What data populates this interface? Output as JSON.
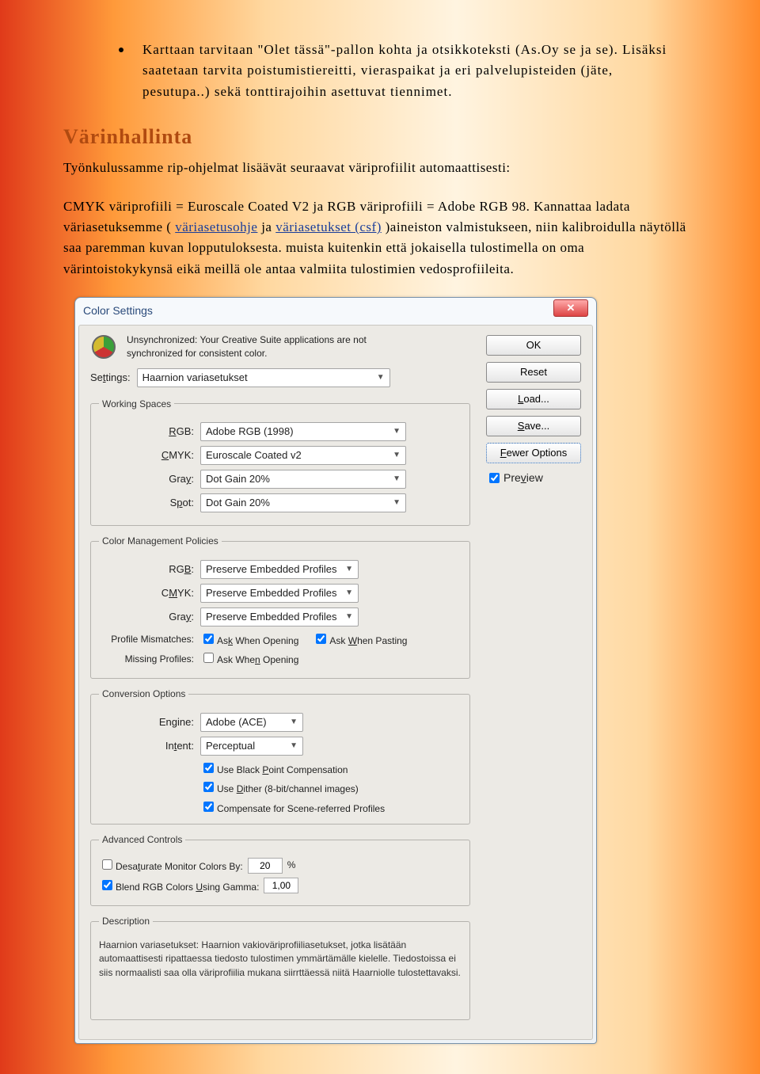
{
  "bullet1": "Karttaan tarvitaan \"Olet tässä\"-pallon kohta ja otsikkoteksti (As.Oy se ja se). Lisäksi saatetaan tarvita poistumistiereitti, vieraspaikat ja eri palvelupisteiden (jäte, pesutupa..) sekä tonttirajoihin asettuvat tiennimet.",
  "heading": "Värinhallinta",
  "para_intro": "Työnkulussamme rip-ohjelmat lisäävät seuraavat väriprofiilit automaattisesti:",
  "para2_a": "CMYK väriprofiili = Euroscale Coated V2 ja RGB väriprofiili =  Adobe RGB 98. Kannattaa ladata väriasetuksemme ( ",
  "para2_link1": "väriasetusohje",
  "para2_b": "  ja  ",
  "para2_link2": "väriasetukset (csf)",
  "para2_c": " )aineiston valmistukseen, niin kalibroidulla näytöllä saa paremman kuvan lopputuloksesta. muista kuitenkin että jokaisella tulostimella on oma värintoistokykynsä eikä meillä ole antaa valmiita tulostimien vedosprofiileita.",
  "dialog": {
    "title": "Color Settings",
    "unsync": "Unsynchronized: Your Creative Suite applications are not synchronized for consistent color.",
    "settings_label": "Settings:",
    "settings_value": "Haarnion variasetukset",
    "group_working": "Working Spaces",
    "rgb_label": "RGB:",
    "rgb_value": "Adobe RGB (1998)",
    "cmyk_label": "CMYK:",
    "cmyk_value": "Euroscale Coated v2",
    "gray_label": "Gray:",
    "gray_value": "Dot Gain 20%",
    "spot_label": "Spot:",
    "spot_value": "Dot Gain 20%",
    "group_policies": "Color Management Policies",
    "p_rgb_v": "Preserve Embedded Profiles",
    "p_cmyk_v": "Preserve Embedded Profiles",
    "p_gray_v": "Preserve Embedded Profiles",
    "mismatch_label": "Profile Mismatches:",
    "mismatch_open": "Ask When Opening",
    "mismatch_paste": "Ask When Pasting",
    "missing_label": "Missing Profiles:",
    "missing_open": "Ask When Opening",
    "group_conversion": "Conversion Options",
    "engine_label": "Engine:",
    "engine_value": "Adobe (ACE)",
    "intent_label": "Intent:",
    "intent_value": "Perceptual",
    "use_bpc": "Use Black Point Compensation",
    "use_dither": "Use Dither (8-bit/channel images)",
    "compensate_scene": "Compensate for Scene-referred Profiles",
    "group_advanced": "Advanced Controls",
    "desat_label": "Desaturate Monitor Colors By:",
    "desat_value": "20",
    "desat_unit": "%",
    "blend_label": "Blend RGB Colors Using Gamma:",
    "blend_value": "1,00",
    "group_description": "Description",
    "description_text": "Haarnion variasetukset:  Haarnion vakioväriprofiiliasetukset, jotka lisätään automaattisesti ripattaessa tiedosto tulostimen ymmärtämälle kielelle. Tiedostoissa ei siis normaalisti saa olla väriprofiilia mukana siirrttäessä niitä Haarniolle tulostettavaksi.",
    "btn_ok": "OK",
    "btn_reset": "Reset",
    "btn_load": "Load...",
    "btn_save": "Save...",
    "btn_fewer": "Fewer Options",
    "preview": "Preview"
  }
}
